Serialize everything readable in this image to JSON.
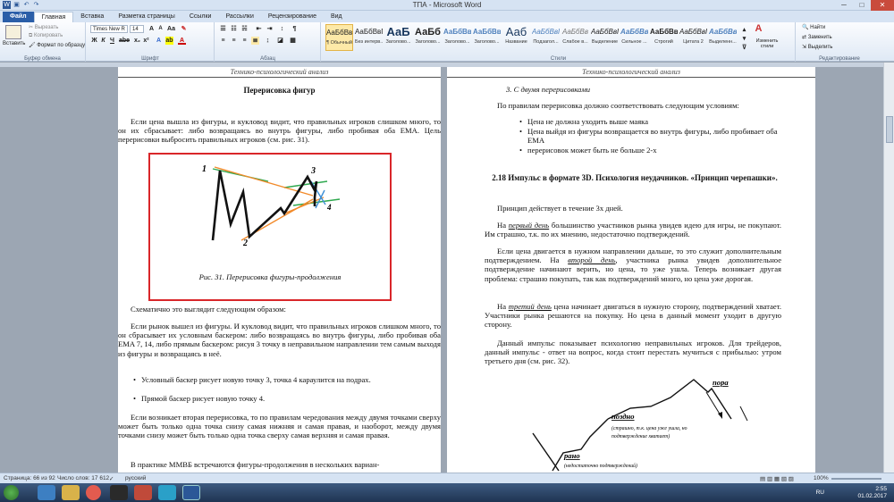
{
  "window": {
    "title": "ТПА - Microsoft Word"
  },
  "tabs": [
    "Файл",
    "Главная",
    "Вставка",
    "Разметка страницы",
    "Ссылки",
    "Рассылки",
    "Рецензирование",
    "Вид"
  ],
  "clipboard": {
    "paste": "Вставить",
    "cut": "Вырезать",
    "copy": "Копировать",
    "format": "Формат по образцу",
    "label": "Буфер обмена"
  },
  "font": {
    "name": "Times New R",
    "size": "14",
    "label": "Шрифт"
  },
  "paragraph": {
    "label": "Абзац"
  },
  "styles": {
    "label": "Стили",
    "items": [
      {
        "preview": "АаБбВвГг,",
        "name": "¶ Обычный"
      },
      {
        "preview": "АаБбВвГг,",
        "name": "Без интерв..."
      },
      {
        "preview": "АаБ",
        "name": "Заголово..."
      },
      {
        "preview": "АаБб",
        "name": "Заголово..."
      },
      {
        "preview": "АаБбВвІ",
        "name": "Заголово..."
      },
      {
        "preview": "АаБбВвГ",
        "name": "Заголово..."
      },
      {
        "preview": "Ааб",
        "name": "Название"
      },
      {
        "preview": "АаБбВвГ",
        "name": "Подзагол..."
      },
      {
        "preview": "АаБбВв",
        "name": "Слабое в..."
      },
      {
        "preview": "АаБбВвГг",
        "name": "Выделение"
      },
      {
        "preview": "АаБбВвГ",
        "name": "Сильное ..."
      },
      {
        "preview": "АаБбВвГг",
        "name": "Строгий"
      },
      {
        "preview": "АаБбВвГг",
        "name": "Цитата 2"
      },
      {
        "preview": "АаБбВвГг",
        "name": "Выделенн..."
      }
    ],
    "change": "Изменить стили"
  },
  "editing": {
    "find": "Найти",
    "replace": "Заменить",
    "select": "Выделить",
    "label": "Редактирование"
  },
  "page1": {
    "header": "Технико-психологический анализ",
    "title": "Перерисовка фигур",
    "para1": "Если цена вышла из фигуры, и кукловод видит, что правильных игроков слишком много, то он их сбрасывает: либо возвращаясь во внутрь фигуры, либо пробивая оба EMA. Цель перерисовки выбросить правильных игроков (см. рис. 31).",
    "fig_caption": "Рис. 31. Перерисовка фигуры-продолжения",
    "fig_labels": [
      "1",
      "2",
      "3",
      "4"
    ],
    "para2": "Схематично это выглядит следующим образом:",
    "para3": "Если рынок вышел из фигуры. И кукловод видит, что правильных игроков слишком много, то он сбрасывает их условным баскером: либо возвращаясь во внутрь фигуры, либо пробивая оба EMA 7, 14, либо прямым баскером: рисуя 3 точку в неправильном направлении тем самым выходя из фигуры и возвращаясь в неё.",
    "bullets": [
      "Условный баскер рисует новую точку 3, точка 4 караулится на подрах.",
      "Прямой баскер рисует новую точку 4."
    ],
    "para4": "Если возникает вторая перерисовка, то по правилам чередования между двумя точками сверху может быть только одна точка снизу самая нижняя и самая правая, и наоборот, между двумя точками снизу может быть только одна точка сверху самая верхняя и самая правая.",
    "para5": "В практике ММВБ встречаются фигуры-продолжения в нескольких вариан-"
  },
  "page2": {
    "header": "Технико-психологический анализ",
    "item3": "3.  С двумя перерисовками",
    "intro": "По правилам перерисовка должно соответствовать следующим условиям:",
    "bullets": [
      "Цена не должна уходить выше маяка",
      "Цена выйдя из фигуры возвращается во внутрь фигуры, либо пробивает оба EMA",
      "перерисовок может быть не больше 2-х"
    ],
    "section": "2.18   Импульс в формате 3D. Психология неудачников. «Принцип черепашки».",
    "p1": "Принцип действует в течение 3х дней.",
    "p2_pre": "На ",
    "p2_em": "первый день",
    "p2_post": " большинство участников рынка увидев идею для игры, не покупают. Им страшно, т.к. по их мнению, недостаточно подтверждений.",
    "p3_pre": "Если цена двигается в нужном направлении дальше, то это служит дополнительным подтверждением. На ",
    "p3_em": "второй день",
    "p3_post": ", участника рынка увидев дополнительное подтверждение начинают верить, но цена, то уже ушла. Теперь возникает другая проблема: страшно покупать, так как подтверждений много, но цена уже дорогая.",
    "p4_pre": "На ",
    "p4_em": "третий день",
    "p4_post": " цена начинает двигаться в нужную сторону, подтверждений хватает. Участники рынка решаются на покупку. Но цена в данный момент уходит в другую сторону.",
    "p5": "Данный импульс показывает психологию неправильных игроков. Для трейдеров, данный импульс - ответ на вопрос, когда стоит перестать мучиться с прибылью: утром третьего дня (см. рис. 32).",
    "fig_labels": {
      "pora": "пора",
      "pozdno": "поздно",
      "pozdno_note1": "(страшно, т.к. цена уже ушла, но",
      "pozdno_note2": "подтверждение хватает)",
      "rano": "рано",
      "rano_note": "(недостаточно подтверждений)"
    }
  },
  "status": {
    "page": "Страница: 66 из 92",
    "words": "Число слов: 17 612",
    "lang": "русский",
    "zoom": "100%"
  },
  "tray": {
    "lang": "RU",
    "time": "2:55",
    "date": "01.02.2017"
  }
}
